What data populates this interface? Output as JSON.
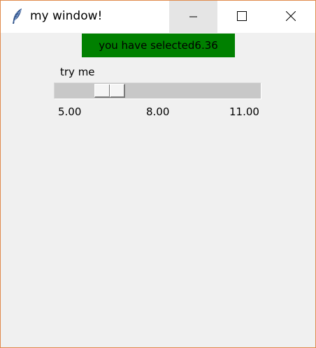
{
  "window": {
    "title": "my window!",
    "icon": "feather-icon",
    "controls": {
      "minimize_icon": "minimize-icon",
      "maximize_icon": "maximize-icon",
      "close_icon": "close-icon"
    }
  },
  "output_label": {
    "text": "you have selected6.36",
    "background_color": "#008000"
  },
  "scale": {
    "label": "try me",
    "from": 5.0,
    "to": 11.0,
    "value": 6.36,
    "tick_labels": [
      "5.00",
      "8.00",
      "11.00"
    ]
  }
}
